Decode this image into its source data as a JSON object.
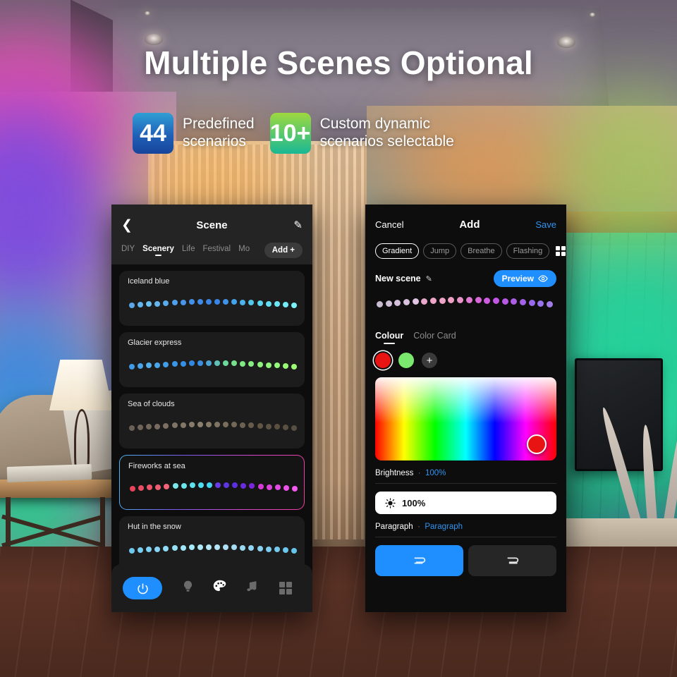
{
  "headline": "Multiple Scenes Optional",
  "badges": [
    {
      "number": "44",
      "text": "Predefined\nscenarios",
      "color": "#2060b8"
    },
    {
      "number": "10+",
      "text": "Custom dynamic\nscenarios selectable",
      "color": "#19b894"
    }
  ],
  "left_panel": {
    "back_icon": "chevron-left-icon",
    "title": "Scene",
    "edit_icon": "pencil-icon",
    "tabs": [
      {
        "label": "DIY",
        "active": false
      },
      {
        "label": "Scenery",
        "active": true
      },
      {
        "label": "Life",
        "active": false
      },
      {
        "label": "Festival",
        "active": false
      },
      {
        "label": "Mo",
        "active": false
      }
    ],
    "add_label": "Add +",
    "scenes": [
      {
        "name": "Iceland blue",
        "selected": false,
        "colors": [
          "#5aa8e8",
          "#62b4ee",
          "#6bc0f2",
          "#63b6f0",
          "#57abee",
          "#4e9fec",
          "#4896ea",
          "#4390e8",
          "#3f8ae6",
          "#3b84e4",
          "#3a86e6",
          "#3f92e8",
          "#45a2ea",
          "#4cb4ec",
          "#53c6ee",
          "#5ad4f0",
          "#62dff2",
          "#6ae6f4",
          "#72ecf6",
          "#7af2f8"
        ]
      },
      {
        "name": "Glacier express",
        "selected": false,
        "colors": [
          "#3f9ae8",
          "#49a4ea",
          "#53aeec",
          "#4aa6ea",
          "#419ee8",
          "#3a96e6",
          "#358fe4",
          "#3189e2",
          "#3a8fe0",
          "#4ca4d4",
          "#5fc0b8",
          "#6ed89a",
          "#77e08c",
          "#80e884",
          "#86ee80",
          "#8cf27c",
          "#90f57a",
          "#94f878",
          "#98fa76",
          "#9cfc74"
        ]
      },
      {
        "name": "Sea of clouds",
        "selected": false,
        "colors": [
          "#6b6056",
          "#6f6459",
          "#73685c",
          "#776c5f",
          "#7b7062",
          "#7f7465",
          "#837868",
          "#877c6b",
          "#8b806e",
          "#857a68",
          "#7f7462",
          "#796e5c",
          "#736856",
          "#6d6250",
          "#675c4a",
          "#615644",
          "#5e5342",
          "#5b5040",
          "#585040",
          "#565044"
        ]
      },
      {
        "name": "Fireworks at sea",
        "selected": true,
        "colors": [
          "#e8455c",
          "#ea4d63",
          "#ec556a",
          "#ee5d71",
          "#f06578",
          "#7ae8ea",
          "#6ce4ec",
          "#5ee0ee",
          "#50dcf0",
          "#42d8f2",
          "#6a3ae8",
          "#5f34e4",
          "#5c2ee0",
          "#6a2ade",
          "#7a26dc",
          "#d43ad8",
          "#dc42de",
          "#e44ae4",
          "#ec52ea",
          "#f45af0"
        ]
      },
      {
        "name": "Hut in the snow",
        "selected": false,
        "colors": [
          "#6ec8f0",
          "#76cdf2",
          "#7ed2f4",
          "#86d7f5",
          "#8edcf6",
          "#96e1f7",
          "#9ee6f8",
          "#a6ebf9",
          "#aee9f8",
          "#b6e7f7",
          "#b2e4f6",
          "#aee1f5",
          "#a4ddf4",
          "#9ad9f3",
          "#90d5f2",
          "#86d1f1",
          "#7ccdf0",
          "#74caef",
          "#6cc7ee",
          "#64c4ed"
        ]
      }
    ],
    "bottom_nav": [
      {
        "icon": "power-icon",
        "active": true
      },
      {
        "icon": "bulb-icon",
        "active": false
      },
      {
        "icon": "palette-icon",
        "active": true
      },
      {
        "icon": "music-note-icon",
        "active": false
      },
      {
        "icon": "grid-icon",
        "active": false
      }
    ]
  },
  "right_panel": {
    "cancel_label": "Cancel",
    "title": "Add",
    "save_label": "Save",
    "modes": [
      {
        "label": "Gradient",
        "active": true
      },
      {
        "label": "Jump",
        "active": false
      },
      {
        "label": "Breathe",
        "active": false
      },
      {
        "label": "Flashing",
        "active": false
      }
    ],
    "grid_icon": "grid-icon",
    "scene_name": "New scene",
    "edit_icon": "pencil-icon",
    "preview_label": "Preview",
    "preview_icon": "eye-icon",
    "preview_colors": [
      "#c8bcd0",
      "#cfc0d6",
      "#d4bfdc",
      "#d9c2e0",
      "#e0c6e4",
      "#e8a8cc",
      "#eda6c8",
      "#efa3c6",
      "#eea0c4",
      "#e894c8",
      "#e07ad0",
      "#d868d8",
      "#cf5ce0",
      "#c356e2",
      "#b858e4",
      "#ad5ce6",
      "#a462e8",
      "#9a68ea",
      "#9a72ec",
      "#a07ce8"
    ],
    "color_tabs": [
      {
        "label": "Colour",
        "active": true
      },
      {
        "label": "Color Card",
        "active": false
      }
    ],
    "swatches": [
      {
        "color": "#e81414",
        "selected": true
      },
      {
        "color": "#7ae86e",
        "selected": false
      }
    ],
    "add_swatch_icon": "plus-icon",
    "picker_handle_color": "#e81414",
    "brightness_label": "Brightness",
    "brightness_value": "100%",
    "brightness_slider_icon": "sun-icon",
    "brightness_slider_value": "100%",
    "paragraph_label": "Paragraph",
    "paragraph_value": "Paragraph",
    "direction_buttons": [
      {
        "icon": "flow-forward-icon",
        "glyph": "⊐",
        "active": true
      },
      {
        "icon": "flow-reverse-icon",
        "glyph": "⊐",
        "active": false
      }
    ]
  }
}
